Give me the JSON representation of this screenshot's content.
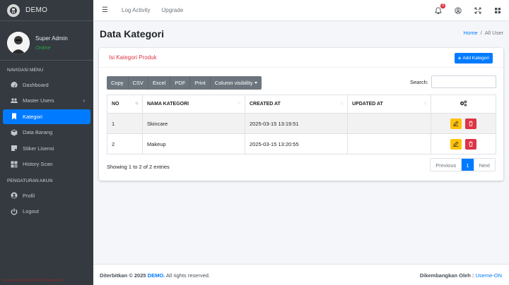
{
  "brand": {
    "name": "DEMO"
  },
  "user": {
    "name": "Super Admin",
    "status": "Online"
  },
  "sidebar": {
    "nav_header": "NAVIGASI MENU",
    "items": [
      {
        "label": "Dashboard",
        "icon": "tachometer-icon"
      },
      {
        "label": "Master Users",
        "icon": "users-icon"
      },
      {
        "label": "Kategori",
        "icon": "bookmark-icon",
        "active": true
      },
      {
        "label": "Data Barang",
        "icon": "cube-icon"
      },
      {
        "label": "Stiker Lisensi",
        "icon": "sticky-note-icon"
      },
      {
        "label": "History Scan",
        "icon": "qrcode-icon"
      }
    ],
    "account_header": "PENGATURAN AKUN",
    "account_items": [
      {
        "label": "Profil",
        "icon": "user-circle-icon"
      },
      {
        "label": "Logout",
        "icon": "power-icon"
      }
    ],
    "footer_url": "localhost/DEVELOPMENT/UsemeON/"
  },
  "navbar": {
    "links": [
      "Log Activity",
      "Upgrade"
    ],
    "notification_count": "0"
  },
  "page": {
    "title": "Data Kategori",
    "breadcrumb_home": "Home",
    "breadcrumb_current": "All User"
  },
  "card": {
    "title": "Isi Kategori Produk",
    "add_button": "Add Kategori"
  },
  "datatable": {
    "buttons": [
      "Copy",
      "CSV",
      "Excel",
      "PDF",
      "Print",
      "Column visibility"
    ],
    "search_label": "Search:",
    "search_value": "",
    "columns": [
      "NO",
      "NAMA KATEGORI",
      "CREATED AT",
      "UPDATED AT"
    ],
    "rows": [
      {
        "no": "1",
        "nama": "Skincare",
        "created": "2025-03-15 13:19:51",
        "updated": ""
      },
      {
        "no": "2",
        "nama": "Makeup",
        "created": "2025-03-15 13:20:55",
        "updated": ""
      }
    ],
    "info": "Showing 1 to 2 of 2 entries",
    "pagination": {
      "previous": "Previous",
      "current": "1",
      "next": "Next"
    }
  },
  "footer": {
    "left_prefix": "Diterbitkan © 2025",
    "left_brand": "DEMO.",
    "left_suffix": "All rights reserved.",
    "right_prefix": "Dikembangkan Oleh :",
    "right_link": "Useme-ON"
  },
  "colors": {
    "primary": "#007bff",
    "sidebar": "#343a40",
    "danger": "#dc3545",
    "warning": "#ffc107",
    "success": "#28a745"
  }
}
